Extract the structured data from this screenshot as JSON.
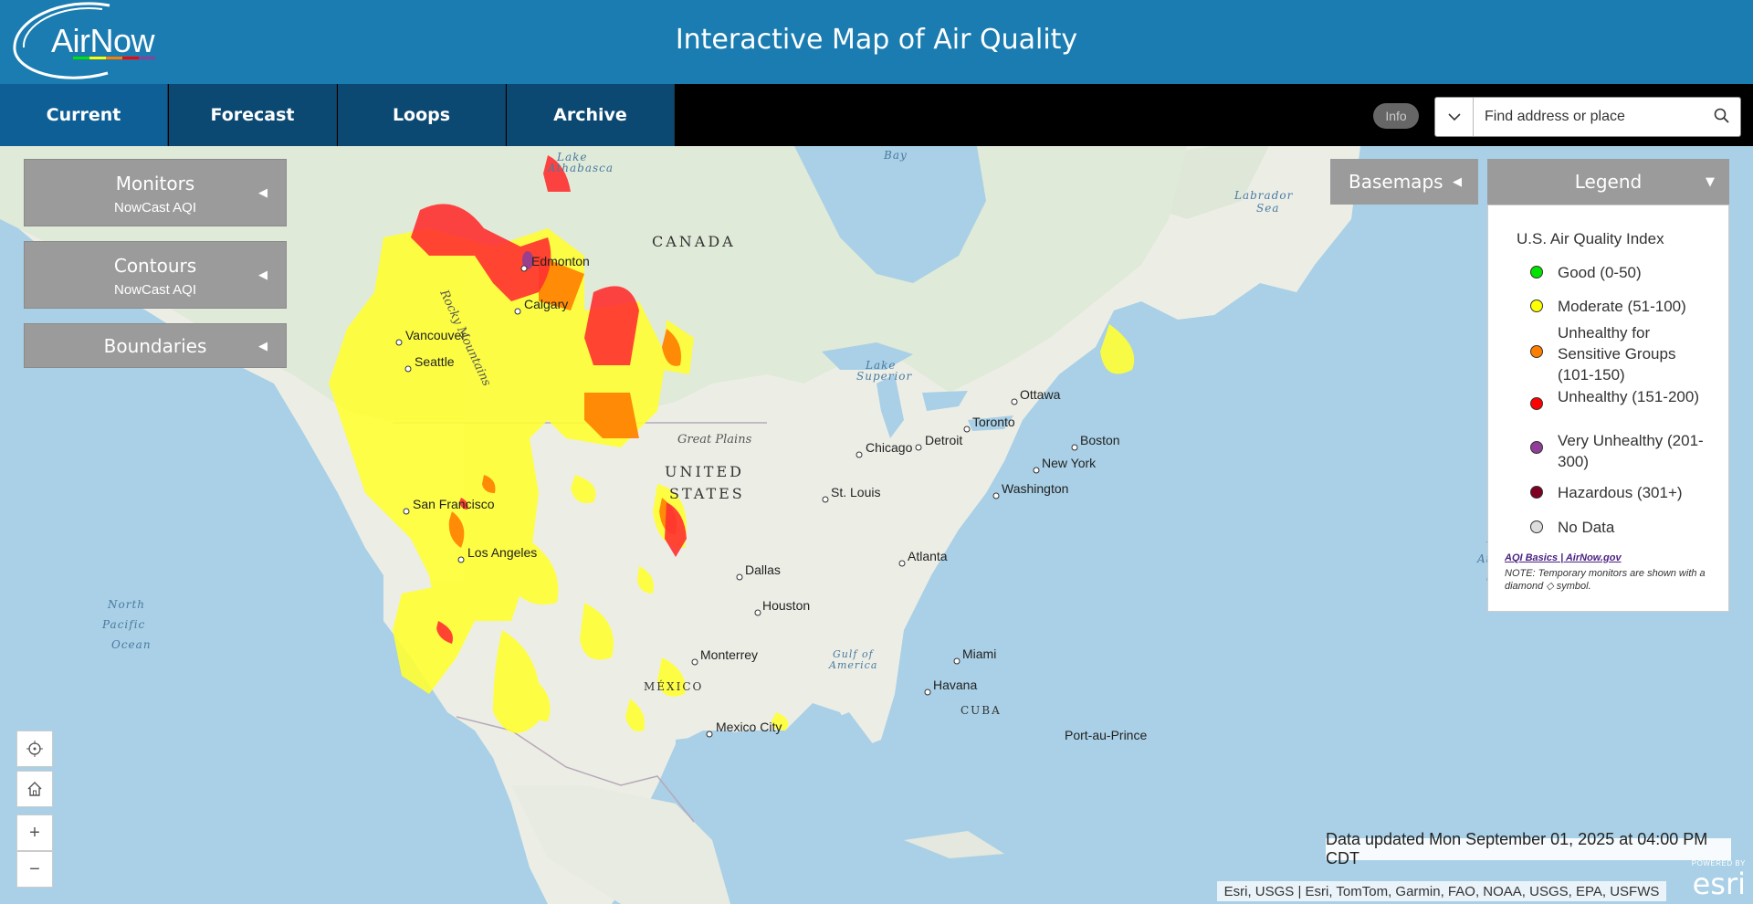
{
  "header": {
    "logo_text": "AirNow",
    "title": "Interactive Map of Air Quality"
  },
  "nav": {
    "tabs": [
      {
        "label": "Current",
        "active": true
      },
      {
        "label": "Forecast",
        "active": false
      },
      {
        "label": "Loops",
        "active": false
      },
      {
        "label": "Archive",
        "active": false
      }
    ],
    "info_label": "Info",
    "search_placeholder": "Find address or place",
    "search_icon": "search-icon",
    "dropdown_icon": "chevron-down-icon"
  },
  "panels": {
    "monitors": {
      "title": "Monitors",
      "subtitle": "NowCast AQI"
    },
    "contours": {
      "title": "Contours",
      "subtitle": "NowCast AQI"
    },
    "boundaries": {
      "title": "Boundaries"
    }
  },
  "basemaps_label": "Basemaps",
  "legend": {
    "header": "Legend",
    "title": "U.S. Air Quality Index",
    "items": [
      {
        "label": "Good (0-50)",
        "color": "#00e400"
      },
      {
        "label": "Moderate (51-100)",
        "color": "#ffff00"
      },
      {
        "label": "Unhealthy for Sensitive Groups (101-150)",
        "color": "#ff7e00"
      },
      {
        "label": "Unhealthy (151-200)",
        "color": "#ff0000"
      },
      {
        "label": "Very Unhealthy (201-300)",
        "color": "#8f3f97"
      },
      {
        "label": "Hazardous (301+)",
        "color": "#7e0023"
      },
      {
        "label": "No Data",
        "color": "#dddddd"
      }
    ],
    "link": "AQI Basics | AirNow.gov",
    "note": "NOTE: Temporary monitors are shown with a diamond ◇ symbol."
  },
  "map_labels": {
    "countries": [
      "CANADA",
      "UNITED",
      "STATES",
      "MÉXICO",
      "CUBA"
    ],
    "cities": [
      "Edmonton",
      "Calgary",
      "Vancouver",
      "Seattle",
      "San Francisco",
      "Los Angeles",
      "Dallas",
      "Houston",
      "Monterrey",
      "Mexico City",
      "Chicago",
      "Detroit",
      "Toronto",
      "Ottawa",
      "Boston",
      "New York",
      "Washington",
      "St. Louis",
      "Atlanta",
      "Miami",
      "Havana",
      "Port-au-Prince"
    ],
    "features": [
      "Lake Athabasca",
      "Hudson Bay",
      "Labrador Sea",
      "Rocky Mountains",
      "Lake Superior",
      "Great Plains",
      "North Pacific Ocean",
      "North Atlantic Ocean",
      "Gulf of America"
    ]
  },
  "map_controls": {
    "locate_icon": "locate-icon",
    "home_icon": "home-icon",
    "zoom_in": "+",
    "zoom_out": "−"
  },
  "updated": "Data updated Mon September 01, 2025 at 04:00 PM CDT",
  "attribution": "Esri, USGS | Esri, TomTom, Garmin, FAO, NOAA, USGS, EPA, USFWS",
  "esri": {
    "powered": "POWERED BY",
    "name": "esri"
  }
}
